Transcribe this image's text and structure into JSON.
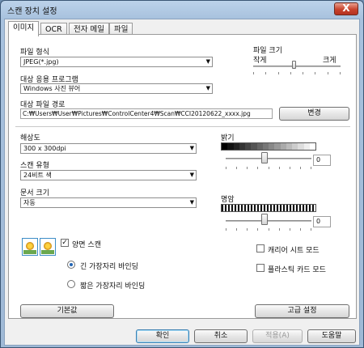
{
  "window": {
    "title": "스캔 장치 설정",
    "close_glyph": "X"
  },
  "tabs": [
    "이미지",
    "OCR",
    "전자 메일",
    "파일"
  ],
  "file_type": {
    "label": "파일 형식",
    "value": "JPEG(*.jpg)"
  },
  "file_size": {
    "label": "파일 크기",
    "small": "작게",
    "large": "크게"
  },
  "target_app": {
    "label": "대상 응용 프로그램",
    "value": "Windows 사진 뷰어"
  },
  "dest_path": {
    "label": "대상 파일 경로",
    "value": "C:₩Users₩User₩Pictures₩ControlCenter4₩Scan₩CCI20120622_xxxx.jpg",
    "change_button": "변경"
  },
  "resolution": {
    "label": "해상도",
    "value": "300 x 300dpi"
  },
  "scan_type": {
    "label": "스캔 유형",
    "value": "24비트 색"
  },
  "doc_size": {
    "label": "문서 크기",
    "value": "자동"
  },
  "brightness": {
    "label": "밝기",
    "value": "0"
  },
  "contrast": {
    "label": "명암",
    "value": "0"
  },
  "duplex": {
    "checkbox_label": "양면 스캔",
    "checked": true,
    "long_edge": "긴 가장자리 바인딩",
    "short_edge": "짧은 가장자리 바인딩",
    "selected": "long_edge"
  },
  "carrier_sheet": {
    "label": "캐리어 시트 모드",
    "checked": false
  },
  "plastic_card": {
    "label": "플라스틱 카드 모드",
    "checked": false
  },
  "buttons": {
    "default": "기본값",
    "advanced": "고급 설정",
    "ok": "확인",
    "cancel": "취소",
    "apply": "적용(A)",
    "help": "도움말"
  },
  "colors": {
    "title_bar": "#a8c2de",
    "panel": "#ffffff",
    "dialog": "#f0f0f0",
    "accent": "#3c7fb1"
  }
}
